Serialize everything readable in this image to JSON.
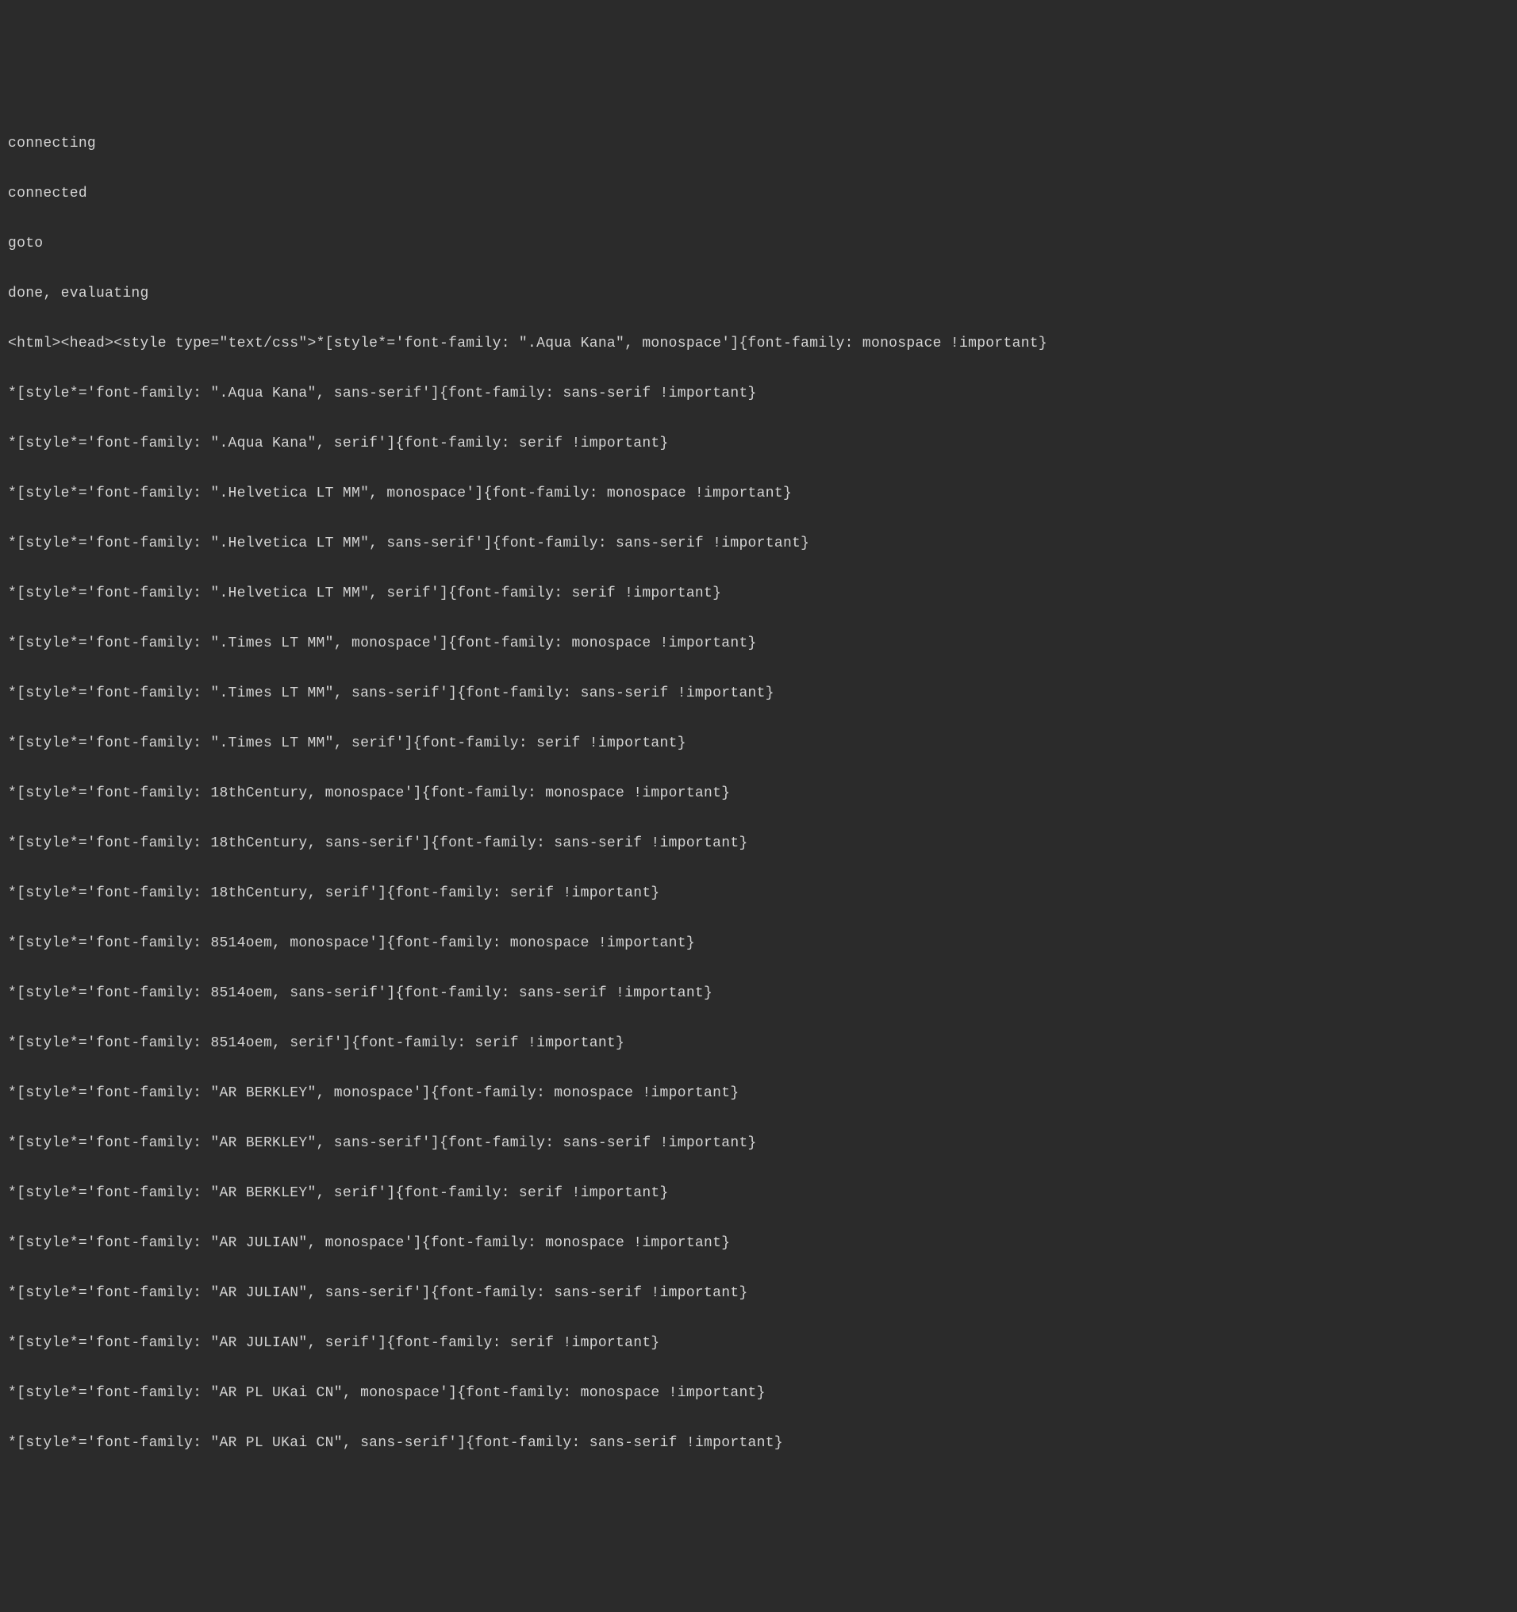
{
  "terminal": {
    "lines": [
      "connecting",
      "connected",
      "goto",
      "done, evaluating",
      "<html><head><style type=\"text/css\">*[style*='font-family: \".Aqua Kana\", monospace']{font-family: monospace !important}",
      "*[style*='font-family: \".Aqua Kana\", sans-serif']{font-family: sans-serif !important}",
      "*[style*='font-family: \".Aqua Kana\", serif']{font-family: serif !important}",
      "*[style*='font-family: \".Helvetica LT MM\", monospace']{font-family: monospace !important}",
      "*[style*='font-family: \".Helvetica LT MM\", sans-serif']{font-family: sans-serif !important}",
      "*[style*='font-family: \".Helvetica LT MM\", serif']{font-family: serif !important}",
      "*[style*='font-family: \".Times LT MM\", monospace']{font-family: monospace !important}",
      "*[style*='font-family: \".Times LT MM\", sans-serif']{font-family: sans-serif !important}",
      "*[style*='font-family: \".Times LT MM\", serif']{font-family: serif !important}",
      "*[style*='font-family: 18thCentury, monospace']{font-family: monospace !important}",
      "*[style*='font-family: 18thCentury, sans-serif']{font-family: sans-serif !important}",
      "*[style*='font-family: 18thCentury, serif']{font-family: serif !important}",
      "*[style*='font-family: 8514oem, monospace']{font-family: monospace !important}",
      "*[style*='font-family: 8514oem, sans-serif']{font-family: sans-serif !important}",
      "*[style*='font-family: 8514oem, serif']{font-family: serif !important}",
      "*[style*='font-family: \"AR BERKLEY\", monospace']{font-family: monospace !important}",
      "*[style*='font-family: \"AR BERKLEY\", sans-serif']{font-family: sans-serif !important}",
      "*[style*='font-family: \"AR BERKLEY\", serif']{font-family: serif !important}",
      "*[style*='font-family: \"AR JULIAN\", monospace']{font-family: monospace !important}",
      "*[style*='font-family: \"AR JULIAN\", sans-serif']{font-family: sans-serif !important}",
      "*[style*='font-family: \"AR JULIAN\", serif']{font-family: serif !important}",
      "*[style*='font-family: \"AR PL UKai CN\", monospace']{font-family: monospace !important}",
      "*[style*='font-family: \"AR PL UKai CN\", sans-serif']{font-family: sans-serif !important}"
    ]
  }
}
